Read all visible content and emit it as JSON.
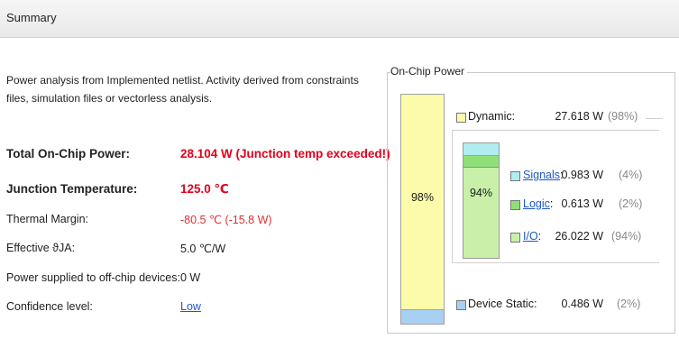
{
  "header": {
    "title": "Summary"
  },
  "description": "Power analysis from Implemented netlist. Activity derived from constraints files, simulation files or vectorless analysis.",
  "summary": {
    "total_power": {
      "label": "Total On-Chip Power:",
      "value": "28.104 W (Junction temp exceeded!)"
    },
    "junction_temp": {
      "label": "Junction Temperature:",
      "value": "125.0 ℃"
    },
    "thermal_margin": {
      "label": "Thermal Margin:",
      "value": "-80.5 ℃ (-15.8 W)"
    },
    "effective_theta": {
      "label": "Effective ϑJA:",
      "value": "5.0 ℃/W"
    },
    "offchip": {
      "label": "Power supplied to off-chip devices:",
      "value": "0 W"
    },
    "confidence": {
      "label": "Confidence level:",
      "value": "Low"
    }
  },
  "on_chip": {
    "title": "On-Chip Power",
    "main_bar_pct": "98%",
    "inner_bar_pct": "94%",
    "dynamic": {
      "label": "Dynamic:",
      "value": "27.618 W",
      "pct": "(98%)"
    },
    "signals": {
      "label": "Signals",
      "colon": ":",
      "value": "0.983 W",
      "pct": "(4%)"
    },
    "logic": {
      "label": "Logic",
      "colon": ":",
      "value": "0.613 W",
      "pct": "(2%)"
    },
    "io": {
      "label": "I/O",
      "colon": ":",
      "value": "26.022 W",
      "pct": "(94%)"
    },
    "device_static": {
      "label": "Device Static:",
      "value": "0.486 W",
      "pct": "(2%)"
    }
  },
  "colors": {
    "dynamic": "#fbfbaa",
    "signals": "#b0ecf0",
    "logic": "#8fe078",
    "io": "#c8f0a8",
    "device_static": "#a8d0f2",
    "alert": "#e3001b",
    "link": "#1e58c8"
  }
}
